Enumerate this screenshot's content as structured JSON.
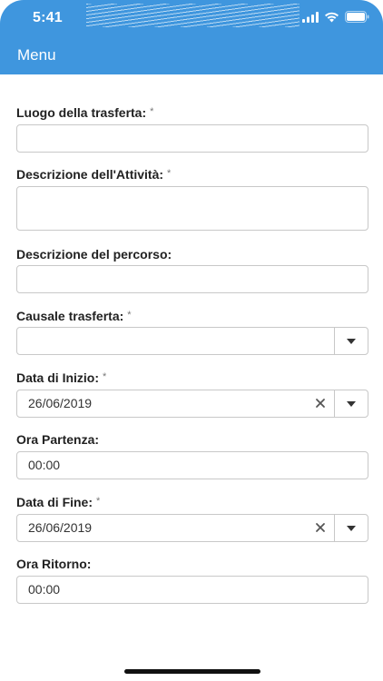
{
  "status_bar": {
    "time": "5:41",
    "icons": [
      "signal-icon",
      "wifi-icon",
      "battery-icon"
    ]
  },
  "header": {
    "menu_label": "Menu",
    "accent_color": "#3f96de"
  },
  "form": {
    "luogo": {
      "label": "Luogo della trasferta:",
      "required": "*",
      "value": ""
    },
    "descrizione_attivita": {
      "label": "Descrizione dell'Attività:",
      "required": "*",
      "value": ""
    },
    "descrizione_percorso": {
      "label": "Descrizione del percorso:",
      "value": ""
    },
    "causale": {
      "label": "Causale trasferta:",
      "required": "*",
      "value": ""
    },
    "data_inizio": {
      "label": "Data di Inizio:",
      "required": "*",
      "value": "26/06/2019"
    },
    "ora_partenza": {
      "label": "Ora Partenza:",
      "value": "00:00"
    },
    "data_fine": {
      "label": "Data di Fine:",
      "required": "*",
      "value": "26/06/2019"
    },
    "ora_ritorno": {
      "label": "Ora Ritorno:",
      "value": "00:00"
    }
  }
}
